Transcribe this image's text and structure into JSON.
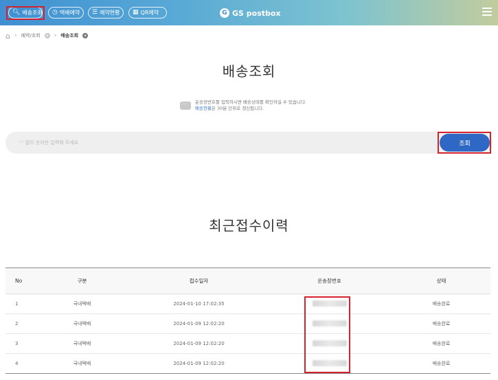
{
  "header": {
    "nav": [
      {
        "label": "배송조회",
        "icon": "search-icon"
      },
      {
        "label": "택배예약",
        "icon": "clock-icon"
      },
      {
        "label": "예약현황",
        "icon": "document-icon"
      },
      {
        "label": "QR예약",
        "icon": "qr-icon"
      }
    ],
    "logo_text": "GS postbox"
  },
  "breadcrumb": {
    "items": [
      "예약/조회",
      "배송조회"
    ]
  },
  "page": {
    "title": "배송조회",
    "info_line1": "운송장번호를 입력하시면 배송상태를 확인하실 수 있습니다.",
    "info_line2_prefix": "배송현황",
    "info_line2_rest": "은 30분 단위로 갱신됩니다."
  },
  "search": {
    "placeholder": "'-' 없이 숫자만 입력해 주세요",
    "button_label": "조회"
  },
  "recent": {
    "title": "최근접수이력",
    "columns": [
      "No",
      "구분",
      "접수일자",
      "운송장번호",
      "상태"
    ],
    "rows": [
      {
        "no": "1",
        "type": "국내택배",
        "date": "2024-01-10 17:02:35",
        "status": "배송완료"
      },
      {
        "no": "2",
        "type": "국내택배",
        "date": "2024-01-09 12:02:20",
        "status": "배송완료"
      },
      {
        "no": "3",
        "type": "국내택배",
        "date": "2024-01-09 12:02:20",
        "status": "배송완료"
      },
      {
        "no": "4",
        "type": "국내택배",
        "date": "2024-01-09 12:02:20",
        "status": "배송완료"
      }
    ]
  },
  "colors": {
    "accent": "#2f68c4",
    "highlight": "#d3212d"
  }
}
